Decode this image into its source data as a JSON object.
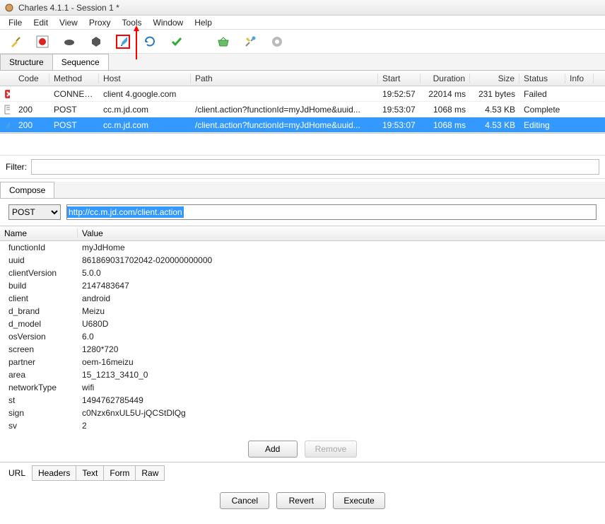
{
  "title": "Charles 4.1.1 - Session 1 *",
  "menu": [
    "File",
    "Edit",
    "View",
    "Proxy",
    "Tools",
    "Window",
    "Help"
  ],
  "mainTabs": {
    "structure": "Structure",
    "sequence": "Sequence"
  },
  "grid": {
    "headers": {
      "code": "Code",
      "method": "Method",
      "host": "Host",
      "path": "Path",
      "start": "Start",
      "duration": "Duration",
      "size": "Size",
      "status": "Status",
      "info": "Info"
    },
    "rows": [
      {
        "icon": "error",
        "code": "",
        "method": "CONNECT",
        "host": "client 4.google.com",
        "path": "",
        "start": "19:52:57",
        "duration": "22014 ms",
        "size": "231 bytes",
        "status": "Failed",
        "selected": false
      },
      {
        "icon": "doc",
        "code": "200",
        "method": "POST",
        "host": "cc.m.jd.com",
        "path": "/client.action?functionId=myJdHome&uuid...",
        "start": "19:53:07",
        "duration": "1068 ms",
        "size": "4.53 KB",
        "status": "Complete",
        "selected": false
      },
      {
        "icon": "edit",
        "code": "200",
        "method": "POST",
        "host": "cc.m.jd.com",
        "path": "/client.action?functionId=myJdHome&uuid...",
        "start": "19:53:07",
        "duration": "1068 ms",
        "size": "4.53 KB",
        "status": "Editing",
        "selected": true
      }
    ]
  },
  "filterLabel": "Filter:",
  "composeTab": "Compose",
  "compose": {
    "method": "POST",
    "url": "http://cc.m.jd.com/client.action"
  },
  "paramsHeader": {
    "name": "Name",
    "value": "Value"
  },
  "params": [
    {
      "name": "functionId",
      "value": "myJdHome"
    },
    {
      "name": "uuid",
      "value": "861869031702042-020000000000"
    },
    {
      "name": "clientVersion",
      "value": "5.0.0"
    },
    {
      "name": "build",
      "value": "2147483647"
    },
    {
      "name": "client",
      "value": "android"
    },
    {
      "name": "d_brand",
      "value": "Meizu"
    },
    {
      "name": "d_model",
      "value": "U680D"
    },
    {
      "name": "osVersion",
      "value": "6.0"
    },
    {
      "name": "screen",
      "value": "1280*720"
    },
    {
      "name": "partner",
      "value": "oem-16meizu"
    },
    {
      "name": "area",
      "value": "15_1213_3410_0"
    },
    {
      "name": "networkType",
      "value": "wifi"
    },
    {
      "name": "st",
      "value": "1494762785449"
    },
    {
      "name": "sign",
      "value": "c0Nzx6nxUL5U-jQCStDlQg"
    },
    {
      "name": "sv",
      "value": "2"
    }
  ],
  "buttons": {
    "add": "Add",
    "remove": "Remove",
    "cancel": "Cancel",
    "revert": "Revert",
    "execute": "Execute"
  },
  "bottomTabs": {
    "label": "URL",
    "tabs": [
      "Headers",
      "Text",
      "Form",
      "Raw"
    ]
  }
}
